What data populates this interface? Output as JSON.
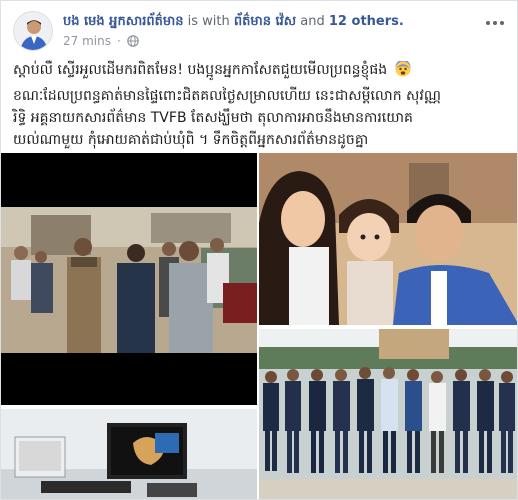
{
  "post": {
    "author_name": "បង មេង អ្នកសារព័ត៌មាន",
    "with_text": "is with",
    "tagged_page": "ព័ត៌មាន វ៉េស",
    "and_text": "and",
    "others_link": "12 others.",
    "timestamp": "27 mins",
    "privacy_icon": "globe-icon",
    "line1": "ស្ដាប់លឺ ស្ទើរអួលដើមករពិតមែន! បងប្អូនអ្នកកាសែតជួយមើលប្រពន្ធខ្ញុំផង",
    "line1_emoji": "fearful-face-emoji",
    "line2": "ខណៈដែលប្រពន្ធគាត់មានផ្ទៃពោះជិតគលថ្ងៃសម្រាលហើយ នេះជាសម្ដីលោក សុវណ្ណ",
    "line3": "រិទ្ធិ អគ្គនាយកសារព័ត៌មាន TVFB តែសង្ឃឹមថា តុលាការអាចនឹងមានការយោគ",
    "line4": "យល់ណាមួយ កុំអោយគាត់ជាប់ឃុំពិ ។ ទឹកចិត្តពីអ្នកសារព័ត៌មានដូចគ្នា"
  },
  "media": {
    "tile1": "police-arrest-scene-photo",
    "tile2": "family-selfie-photo",
    "tile3": "ultrasound-monitor-photo",
    "tile4": "journalists-group-photo"
  },
  "colors": {
    "link": "#385898",
    "text": "#1c1e21",
    "meta": "#90949c"
  }
}
